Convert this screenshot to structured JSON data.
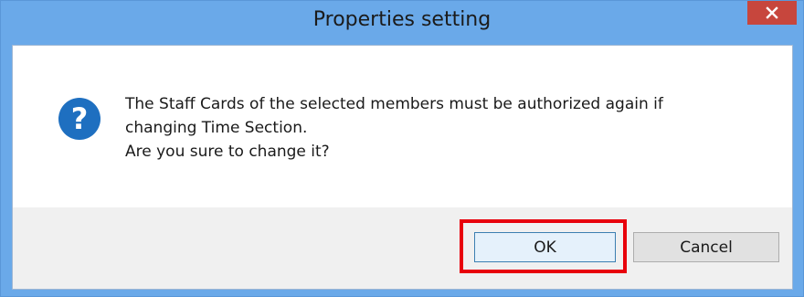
{
  "window": {
    "title": "Properties setting",
    "close_icon": "close-icon"
  },
  "message": {
    "icon": "question-icon",
    "lines": [
      "The Staff Cards of the selected members must be authorized again if",
      "changing Time Section.",
      "Are you sure to change it?"
    ]
  },
  "buttons": {
    "ok_label": "OK",
    "cancel_label": "Cancel"
  },
  "colors": {
    "titlebar": "#6aa9e9",
    "close_button": "#c7463d",
    "icon_blue": "#1e6fc0",
    "highlight": "#e8000b",
    "button_strip": "#f0f0f0"
  }
}
